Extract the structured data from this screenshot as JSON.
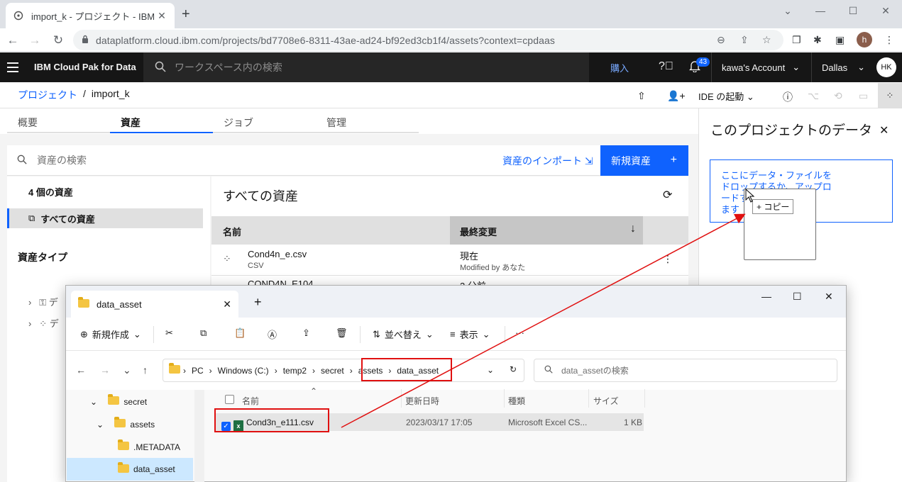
{
  "browser": {
    "tab_title": "import_k - プロジェクト - IBM Cloud",
    "url": "dataplatform.cloud.ibm.com/projects/bd7708e6-8311-43ae-ad24-bf92ed3cb1f4/assets?context=cpdaas",
    "profile_initial": "h"
  },
  "header": {
    "brand": "IBM Cloud Pak for Data",
    "search_placeholder": "ワークスペース内の検索",
    "buy": "購入",
    "notifications": "43",
    "account": "kawa's Account",
    "region": "Dallas",
    "avatar": "HK"
  },
  "breadcrumb": {
    "root": "プロジェクト",
    "sep": "/",
    "current": "import_k"
  },
  "toolbar": {
    "ide": "IDE の起動"
  },
  "tabs": [
    "概要",
    "資産",
    "ジョブ",
    "管理"
  ],
  "assets": {
    "search_placeholder": "資産の検索",
    "import": "資産のインポート",
    "new_asset": "新規資産",
    "count": "4 個の資産",
    "all": "すべての資産",
    "types_heading": "資産タイプ",
    "tree": [
      "デ",
      "デ"
    ],
    "list_title": "すべての資産",
    "col_name": "名前",
    "col_modified": "最終変更",
    "rows": [
      {
        "name": "Cond4n_e.csv",
        "type": "CSV",
        "modified": "現在",
        "by": "Modified by あなた"
      },
      {
        "name": "COND4N_E104",
        "type": "",
        "modified": "2 分前",
        "by": ""
      }
    ]
  },
  "datapanel": {
    "title": "このプロジェクトのデータ",
    "drop_text": "ここにデータ・ファイルをドロップするか、アップロードするファイルを参照します",
    "drop_line1": "ここにデータ・ファイルを",
    "drop_line2": "ドロップするか、アップロ",
    "drop_line3": "ードす",
    "drop_line3b": "照し",
    "drop_line4": "ます",
    "copy_badge": "+ コピー"
  },
  "explorer": {
    "tab_title": "data_asset",
    "cmd": {
      "new": "新規作成",
      "sort": "並べ替え",
      "view": "表示"
    },
    "path": [
      "PC",
      "Windows (C:)",
      "temp2",
      "secret",
      "assets",
      "data_asset"
    ],
    "search_placeholder": "data_assetの検索",
    "nav": [
      {
        "label": "secret"
      },
      {
        "label": "assets"
      },
      {
        "label": ".METADATA"
      },
      {
        "label": "data_asset"
      }
    ],
    "columns": {
      "name": "名前",
      "date": "更新日時",
      "type": "種類",
      "size": "サイズ"
    },
    "file": {
      "name": "Cond3n_e111.csv",
      "date": "2023/03/17 17:05",
      "type": "Microsoft Excel CS...",
      "size": "1 KB"
    }
  },
  "colors": {
    "ibm_blue": "#0f62fe",
    "annotation_red": "#e01010",
    "header_bg": "#161616"
  }
}
